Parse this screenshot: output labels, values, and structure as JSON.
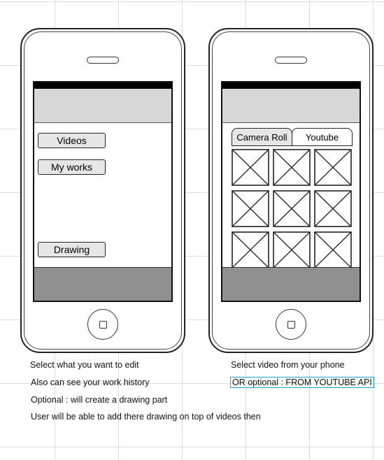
{
  "left_phone": {
    "buttons": [
      {
        "label": "Videos"
      },
      {
        "label": "My works"
      },
      {
        "label": "Drawing"
      }
    ]
  },
  "right_phone": {
    "tabs": [
      {
        "label": "Camera Roll"
      },
      {
        "label": "Youtube"
      }
    ],
    "thumbnail_placeholder": "image-placeholder-icon"
  },
  "notes_left": [
    "Select what you want to edit",
    "Also can see your work history",
    "Optional : will create a drawing part",
    "User will be able to add there drawing on top of videos then"
  ],
  "notes_right": [
    "Select video from your phone",
    "OR optional : FROM YOUTUBE API"
  ]
}
